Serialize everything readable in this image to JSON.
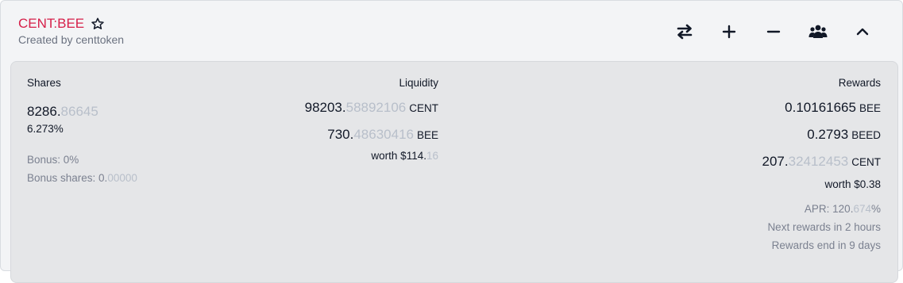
{
  "pool": {
    "title": "CENT:BEE",
    "created_by": "Created by centtoken",
    "accent_color": "#d6204a"
  },
  "actions": [
    {
      "name": "swap-icon"
    },
    {
      "name": "plus-icon"
    },
    {
      "name": "minus-icon"
    },
    {
      "name": "users-icon"
    },
    {
      "name": "chevron-up-icon"
    }
  ],
  "shares": {
    "heading": "Shares",
    "value_int": "8286.",
    "value_dec": "86645",
    "percent": "6.273%",
    "bonus": "Bonus: 0%",
    "bonus_shares_label": "Bonus shares: 0.",
    "bonus_shares_dec": "00000"
  },
  "liquidity": {
    "heading": "Liquidity",
    "cent_int": "98203.",
    "cent_dec": "58892106",
    "cent_unit": "CENT",
    "bee_int": "730.",
    "bee_dec": "48630416",
    "bee_unit": "BEE",
    "worth_main": "worth $114.",
    "worth_dec": "16"
  },
  "rewards": {
    "heading": "Rewards",
    "bee_value": "0.10161665",
    "bee_unit": "BEE",
    "beed_value": "0.2793",
    "beed_unit": "BEED",
    "cent_int": "207.",
    "cent_dec": "32412453",
    "cent_unit": "CENT",
    "worth": "worth $0.38",
    "apr_label": "APR: 120.",
    "apr_dec": "674",
    "apr_suffix": "%",
    "next_rewards": "Next rewards in 2 hours",
    "rewards_end": "Rewards end in 9 days"
  }
}
